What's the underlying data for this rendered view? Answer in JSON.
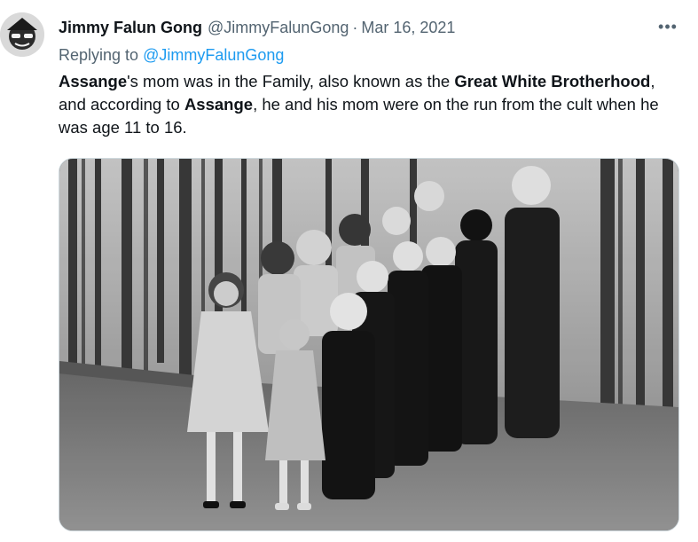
{
  "author": {
    "name": "Jimmy Falun Gong",
    "handle": "@JimmyFalunGong",
    "separator": "·",
    "date": "Mar 16, 2021",
    "avatar_icon": "avatar-icon"
  },
  "more_label": "•••",
  "replying": {
    "prefix": "Replying to",
    "handle": "@JimmyFalunGong"
  },
  "tweet": {
    "parts": [
      {
        "text": "Assange",
        "bold": true
      },
      {
        "text": "'s mom was in the Family, also known as the ",
        "bold": false
      },
      {
        "text": "Great White Brotherhood",
        "bold": true
      },
      {
        "text": ", and according to ",
        "bold": false
      },
      {
        "text": "Assange",
        "bold": true
      },
      {
        "text": ", he and his mom were on the run from the cult when he was age 11 to 16.",
        "bold": false
      }
    ]
  },
  "media": {
    "kind": "photo",
    "style": "black-and-white"
  },
  "colors": {
    "text": "#0f1419",
    "secondary": "#536471",
    "link": "#1d9bf0"
  }
}
